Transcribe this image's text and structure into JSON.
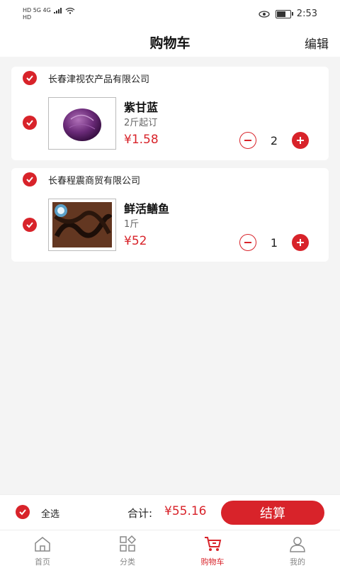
{
  "status_bar": {
    "left_top": "HD 5G 4G",
    "left_bottom": "HD",
    "time": "2:53",
    "battery_level": 0.6
  },
  "header": {
    "title": "购物车",
    "edit_label": "编辑"
  },
  "shops": [
    {
      "name": "长春津视农产品有限公司",
      "items": [
        {
          "name": "紫甘蓝",
          "spec": "2斤起订",
          "price": "¥1.58",
          "quantity": "2",
          "image_icon": "red-cabbage-image"
        }
      ]
    },
    {
      "name": "长春程震商贸有限公司",
      "items": [
        {
          "name": "鲜活鳝鱼",
          "spec": "1斤",
          "price": "¥52",
          "quantity": "1",
          "image_icon": "eel-image"
        }
      ]
    }
  ],
  "checkout": {
    "select_all_label": "全选",
    "total_label": "合计:",
    "total_value": "¥55.16",
    "pay_label": "结算"
  },
  "tabs": [
    {
      "label": "首页",
      "icon": "home-icon",
      "active": false
    },
    {
      "label": "分类",
      "icon": "category-icon",
      "active": false
    },
    {
      "label": "购物车",
      "icon": "cart-icon",
      "active": true
    },
    {
      "label": "我的",
      "icon": "profile-icon",
      "active": false
    }
  ],
  "colors": {
    "accent": "#d8232a",
    "background": "#f4f4f4"
  }
}
